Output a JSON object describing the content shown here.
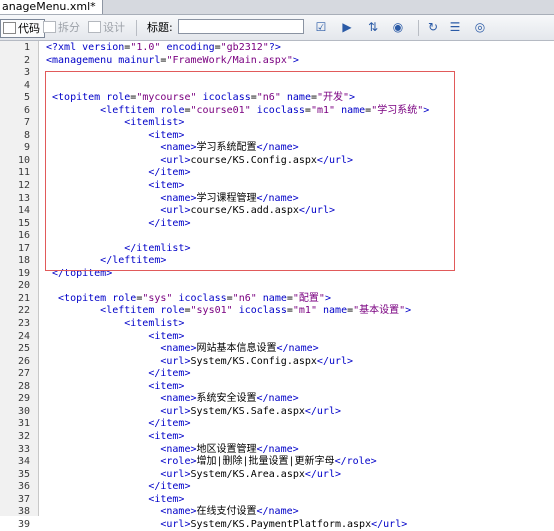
{
  "tab": {
    "label": "anageMenu.xml*"
  },
  "toolbar": {
    "code_label": "代码",
    "split_label": "拆分",
    "design_label": "设计",
    "title_label": "标题:",
    "title_value": ""
  },
  "editor": {
    "lines": [
      {
        "n": "1",
        "indent": 0,
        "parts": [
          [
            "t",
            "<?xml "
          ],
          [
            "a",
            "version"
          ],
          [
            "x",
            "="
          ],
          [
            "v",
            "\"1.0\""
          ],
          [
            "a",
            " encoding"
          ],
          [
            "x",
            "="
          ],
          [
            "v",
            "\"gb2312\""
          ],
          [
            "t",
            "?>"
          ]
        ]
      },
      {
        "n": "2",
        "indent": 0,
        "parts": [
          [
            "t",
            "<managemenu "
          ],
          [
            "a",
            "mainurl"
          ],
          [
            "x",
            "="
          ],
          [
            "v",
            "\"FrameWork/Main.aspx\""
          ],
          [
            "t",
            ">"
          ]
        ]
      },
      {
        "n": "3",
        "indent": 0,
        "parts": []
      },
      {
        "n": "4",
        "indent": 0,
        "parts": []
      },
      {
        "n": "5",
        "indent": 1,
        "parts": [
          [
            "t",
            "<topitem "
          ],
          [
            "a",
            "role"
          ],
          [
            "x",
            "="
          ],
          [
            "v",
            "\"mycourse\""
          ],
          [
            "a",
            " icoclass"
          ],
          [
            "x",
            "="
          ],
          [
            "v",
            "\"n6\""
          ],
          [
            "a",
            " name"
          ],
          [
            "x",
            "="
          ],
          [
            "v",
            "\"开发\""
          ],
          [
            "t",
            ">"
          ]
        ]
      },
      {
        "n": "6",
        "indent": 9,
        "parts": [
          [
            "t",
            "<leftitem "
          ],
          [
            "a",
            "role"
          ],
          [
            "x",
            "="
          ],
          [
            "v",
            "\"course01\""
          ],
          [
            "a",
            " icoclass"
          ],
          [
            "x",
            "="
          ],
          [
            "v",
            "\"m1\""
          ],
          [
            "a",
            " name"
          ],
          [
            "x",
            "="
          ],
          [
            "v",
            "\"学习系统\""
          ],
          [
            "t",
            ">"
          ]
        ]
      },
      {
        "n": "7",
        "indent": 13,
        "parts": [
          [
            "t",
            "<itemlist>"
          ]
        ]
      },
      {
        "n": "8",
        "indent": 17,
        "parts": [
          [
            "t",
            "<item>"
          ]
        ]
      },
      {
        "n": "9",
        "indent": 19,
        "parts": [
          [
            "t",
            "<name>"
          ],
          [
            "x",
            "学习系统配置"
          ],
          [
            "t",
            "</name>"
          ]
        ]
      },
      {
        "n": "10",
        "indent": 19,
        "parts": [
          [
            "t",
            "<url>"
          ],
          [
            "x",
            "course/KS.Config.aspx"
          ],
          [
            "t",
            "</url>"
          ]
        ]
      },
      {
        "n": "11",
        "indent": 17,
        "parts": [
          [
            "t",
            "</item>"
          ]
        ]
      },
      {
        "n": "12",
        "indent": 17,
        "parts": [
          [
            "t",
            "<item>"
          ]
        ]
      },
      {
        "n": "13",
        "indent": 19,
        "parts": [
          [
            "t",
            "<name>"
          ],
          [
            "x",
            "学习课程管理"
          ],
          [
            "t",
            "</name>"
          ]
        ]
      },
      {
        "n": "14",
        "indent": 19,
        "parts": [
          [
            "t",
            "<url>"
          ],
          [
            "x",
            "course/KS.add.aspx"
          ],
          [
            "t",
            "</url>"
          ]
        ]
      },
      {
        "n": "15",
        "indent": 17,
        "parts": [
          [
            "t",
            "</item>"
          ]
        ]
      },
      {
        "n": "16",
        "indent": 0,
        "parts": []
      },
      {
        "n": "17",
        "indent": 13,
        "parts": [
          [
            "t",
            "</itemlist>"
          ]
        ]
      },
      {
        "n": "18",
        "indent": 9,
        "parts": [
          [
            "t",
            "</leftitem>"
          ]
        ]
      },
      {
        "n": "19",
        "indent": 1,
        "parts": [
          [
            "t",
            "</topitem>"
          ]
        ]
      },
      {
        "n": "20",
        "indent": 0,
        "parts": []
      },
      {
        "n": "21",
        "indent": 2,
        "parts": [
          [
            "t",
            "<topitem "
          ],
          [
            "a",
            "role"
          ],
          [
            "x",
            "="
          ],
          [
            "v",
            "\"sys\""
          ],
          [
            "a",
            " icoclass"
          ],
          [
            "x",
            "="
          ],
          [
            "v",
            "\"n6\""
          ],
          [
            "a",
            " name"
          ],
          [
            "x",
            "="
          ],
          [
            "v",
            "\"配置\""
          ],
          [
            "t",
            ">"
          ]
        ]
      },
      {
        "n": "22",
        "indent": 9,
        "parts": [
          [
            "t",
            "<leftitem "
          ],
          [
            "a",
            "role"
          ],
          [
            "x",
            "="
          ],
          [
            "v",
            "\"sys01\""
          ],
          [
            "a",
            " icoclass"
          ],
          [
            "x",
            "="
          ],
          [
            "v",
            "\"m1\""
          ],
          [
            "a",
            " name"
          ],
          [
            "x",
            "="
          ],
          [
            "v",
            "\"基本设置\""
          ],
          [
            "t",
            ">"
          ]
        ]
      },
      {
        "n": "23",
        "indent": 13,
        "parts": [
          [
            "t",
            "<itemlist>"
          ]
        ]
      },
      {
        "n": "24",
        "indent": 17,
        "parts": [
          [
            "t",
            "<item>"
          ]
        ]
      },
      {
        "n": "25",
        "indent": 19,
        "parts": [
          [
            "t",
            "<name>"
          ],
          [
            "x",
            "网站基本信息设置"
          ],
          [
            "t",
            "</name>"
          ]
        ]
      },
      {
        "n": "26",
        "indent": 19,
        "parts": [
          [
            "t",
            "<url>"
          ],
          [
            "x",
            "System/KS.Config.aspx"
          ],
          [
            "t",
            "</url>"
          ]
        ]
      },
      {
        "n": "27",
        "indent": 17,
        "parts": [
          [
            "t",
            "</item>"
          ]
        ]
      },
      {
        "n": "28",
        "indent": 17,
        "parts": [
          [
            "t",
            "<item>"
          ]
        ]
      },
      {
        "n": "29",
        "indent": 19,
        "parts": [
          [
            "t",
            "<name>"
          ],
          [
            "x",
            "系统安全设置"
          ],
          [
            "t",
            "</name>"
          ]
        ]
      },
      {
        "n": "30",
        "indent": 19,
        "parts": [
          [
            "t",
            "<url>"
          ],
          [
            "x",
            "System/KS.Safe.aspx"
          ],
          [
            "t",
            "</url>"
          ]
        ]
      },
      {
        "n": "31",
        "indent": 17,
        "parts": [
          [
            "t",
            "</item>"
          ]
        ]
      },
      {
        "n": "32",
        "indent": 17,
        "parts": [
          [
            "t",
            "<item>"
          ]
        ]
      },
      {
        "n": "33",
        "indent": 19,
        "parts": [
          [
            "t",
            "<name>"
          ],
          [
            "x",
            "地区设置管理"
          ],
          [
            "t",
            "</name>"
          ]
        ]
      },
      {
        "n": "34",
        "indent": 19,
        "parts": [
          [
            "t",
            "<role>"
          ],
          [
            "x",
            "增加|删除|批量设置|更新字母"
          ],
          [
            "t",
            "</role>"
          ]
        ]
      },
      {
        "n": "35",
        "indent": 19,
        "parts": [
          [
            "t",
            "<url>"
          ],
          [
            "x",
            "System/KS.Area.aspx"
          ],
          [
            "t",
            "</url>"
          ]
        ]
      },
      {
        "n": "36",
        "indent": 17,
        "parts": [
          [
            "t",
            "</item>"
          ]
        ]
      },
      {
        "n": "37",
        "indent": 17,
        "parts": [
          [
            "t",
            "<item>"
          ]
        ]
      },
      {
        "n": "38",
        "indent": 19,
        "parts": [
          [
            "t",
            "<name>"
          ],
          [
            "x",
            "在线支付设置"
          ],
          [
            "t",
            "</name>"
          ]
        ]
      },
      {
        "n": "39",
        "indent": 19,
        "parts": [
          [
            "t",
            "<url>"
          ],
          [
            "x",
            "System/KS.PaymentPlatform.aspx"
          ],
          [
            "t",
            "</url>"
          ]
        ]
      }
    ]
  }
}
